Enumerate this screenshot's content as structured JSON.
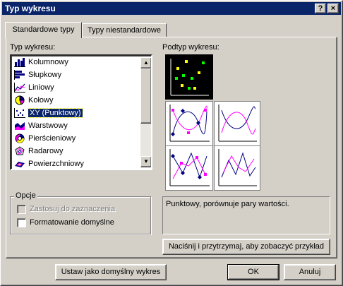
{
  "window": {
    "title": "Typ wykresu",
    "help_glyph": "?",
    "close_glyph": "×"
  },
  "tabs": [
    {
      "label": "Standardowe typy",
      "active": true
    },
    {
      "label": "Typy niestandardowe",
      "active": false
    }
  ],
  "chart_type": {
    "label": "Typ wykresu:",
    "items": [
      {
        "label": "Kolumnowy",
        "icon": "column-chart-icon"
      },
      {
        "label": "Słupkowy",
        "icon": "bar-chart-icon"
      },
      {
        "label": "Liniowy",
        "icon": "line-chart-icon"
      },
      {
        "label": "Kołowy",
        "icon": "pie-chart-icon"
      },
      {
        "label": "XY (Punktowy)",
        "icon": "scatter-chart-icon",
        "selected": true
      },
      {
        "label": "Warstwowy",
        "icon": "area-chart-icon"
      },
      {
        "label": "Pierścieniowy",
        "icon": "doughnut-chart-icon"
      },
      {
        "label": "Radarowy",
        "icon": "radar-chart-icon"
      },
      {
        "label": "Powierzchniowy",
        "icon": "surface-chart-icon"
      }
    ]
  },
  "subtype": {
    "label": "Podtyp wykresu:",
    "description": "Punktowy, porównuje pary wartości."
  },
  "options": {
    "legend": "Opcje",
    "apply_to_selection": {
      "label": "Zastosuj do zaznaczenia",
      "checked": false,
      "disabled": true
    },
    "default_formatting": {
      "label": "Formatowanie domyślne",
      "checked": false,
      "disabled": false
    }
  },
  "buttons": {
    "preview": "Naciśnij i przytrzymaj, aby zobaczyć przykład",
    "set_default": "Ustaw jako domyślny wykres",
    "ok": "OK",
    "cancel": "Anuluj"
  },
  "colors": {
    "titlebar": "#0a246a",
    "selection": "#0a246a",
    "face": "#d4d0c8",
    "series_1": "#000080",
    "series_2": "#ff00ff"
  }
}
